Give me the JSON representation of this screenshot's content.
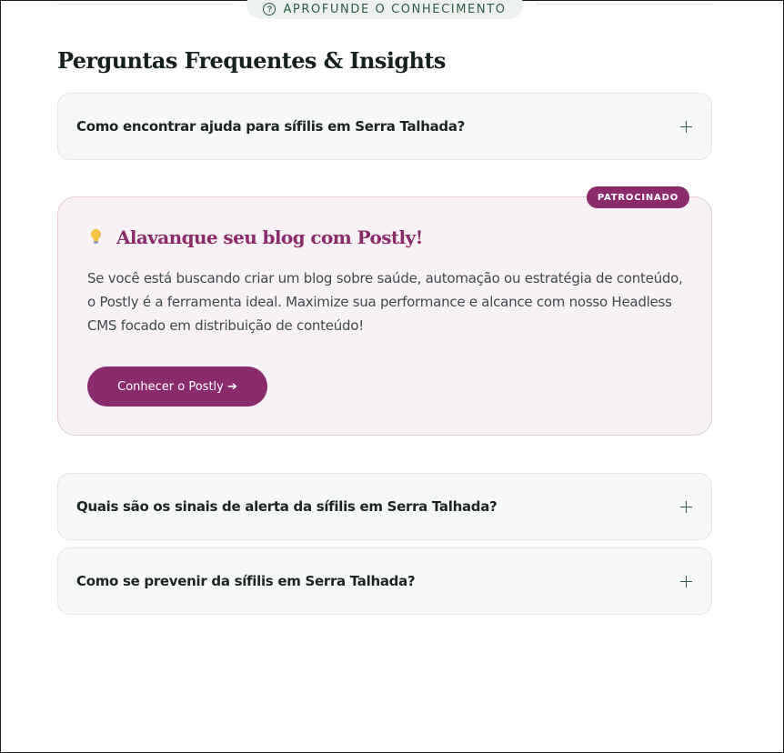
{
  "section_divider": {
    "label": "Aprofunde o conhecimento",
    "icon": "question-circle-icon"
  },
  "faq": {
    "title": "Perguntas Frequentes & Insights",
    "items": [
      {
        "question": "Como encontrar ajuda para sífilis em Serra Talhada?",
        "icon": "plus-icon"
      },
      {
        "question": "Quais são os sinais de alerta da sífilis em Serra Talhada?",
        "icon": "plus-icon"
      },
      {
        "question": "Como se prevenir da sífilis em Serra Talhada?",
        "icon": "plus-icon"
      }
    ]
  },
  "sponsor": {
    "badge": "PATROCINADO",
    "icon": "lightbulb-icon",
    "title": "Alavanque seu blog com Postly!",
    "text": "Se você está buscando criar um blog sobre saúde, automação ou estratégia de conteúdo, o Postly é a ferramenta ideal. Maximize sua performance e alcance com nosso Headless CMS focado em distribuição de conteúdo!",
    "button_label": "Conhecer o Postly ➔"
  },
  "colors": {
    "accent_green": "#2f5a47",
    "sponsor_purple": "#8a2c6c",
    "faq_bg": "#f7f8fa",
    "sponsor_bg": "#f8f1f5"
  }
}
